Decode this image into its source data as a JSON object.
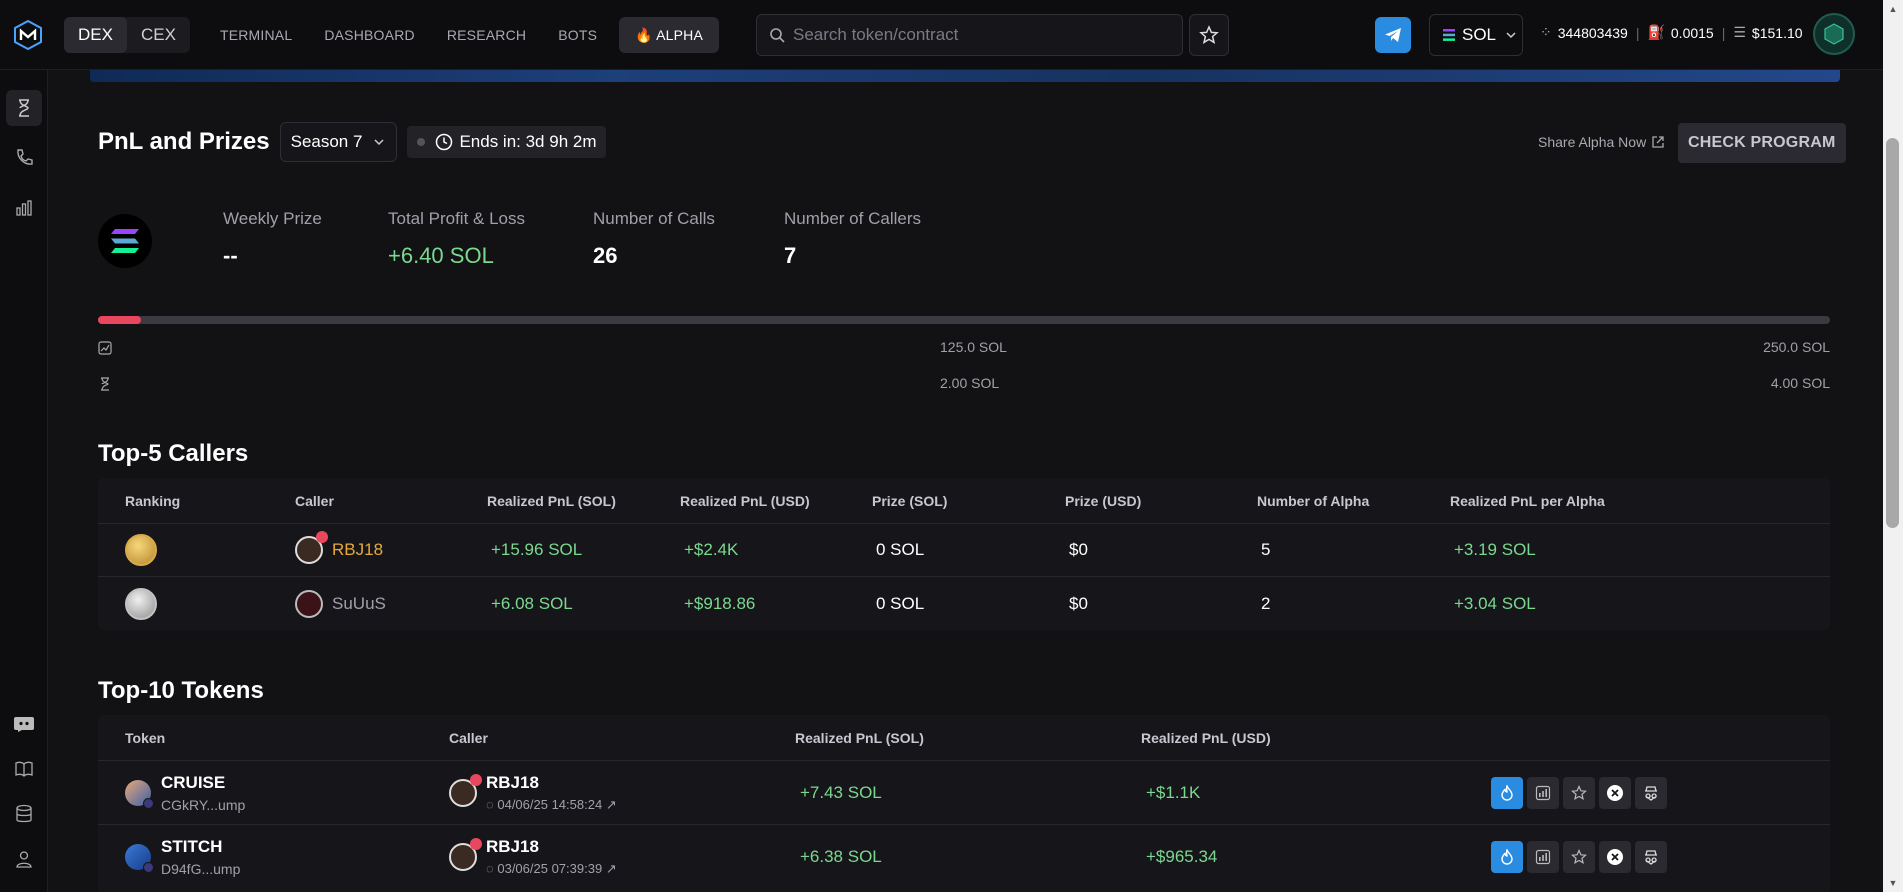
{
  "topbar": {
    "mode_tabs": [
      "DEX",
      "CEX"
    ],
    "nav": [
      "TERMINAL",
      "DASHBOARD",
      "RESEARCH",
      "BOTS"
    ],
    "alpha_label": "ALPHA",
    "search_placeholder": "Search token/contract",
    "chain": "SOL",
    "stats": {
      "block": "344803439",
      "gas": "0.0015",
      "price": "$151.10"
    }
  },
  "header": {
    "title": "PnL and Prizes",
    "season": "Season 7",
    "ends": "Ends in: 3d 9h 2m",
    "share": "Share Alpha Now",
    "check_program": "CHECK PROGRAM"
  },
  "metrics": {
    "weekly_prize_label": "Weekly Prize",
    "weekly_prize": "--",
    "total_pnl_label": "Total Profit & Loss",
    "total_pnl": "+6.40 SOL",
    "calls_label": "Number of Calls",
    "calls": "26",
    "callers_label": "Number of Callers",
    "callers": "7"
  },
  "progress": {
    "fill_fraction": 0.025,
    "pnl_mid": "125.0 SOL",
    "pnl_end": "250.0 SOL",
    "prize_mid": "2.00 SOL",
    "prize_end": "4.00 SOL"
  },
  "top_callers": {
    "title": "Top-5 Callers",
    "headers": [
      "Ranking",
      "Caller",
      "Realized PnL (SOL)",
      "Realized PnL (USD)",
      "Prize (SOL)",
      "Prize (USD)",
      "Number of Alpha",
      "Realized PnL per Alpha"
    ],
    "rows": [
      {
        "caller": "RBJ18",
        "pnl_sol": "+15.96 SOL",
        "pnl_usd": "+$2.4K",
        "prize_sol": "0 SOL",
        "prize_usd": "$0",
        "alpha": "5",
        "per_alpha": "+3.19 SOL"
      },
      {
        "caller": "SuUuS",
        "pnl_sol": "+6.08 SOL",
        "pnl_usd": "+$918.86",
        "prize_sol": "0 SOL",
        "prize_usd": "$0",
        "alpha": "2",
        "per_alpha": "+3.04 SOL"
      }
    ]
  },
  "top_tokens": {
    "title": "Top-10 Tokens",
    "headers": [
      "Token",
      "Caller",
      "Realized PnL (SOL)",
      "Realized PnL (USD)"
    ],
    "rows": [
      {
        "name": "CRUISE",
        "addr": "CGkRY...ump",
        "caller": "RBJ18",
        "time": "04/06/25 14:58:24",
        "pnl_sol": "+7.43 SOL",
        "pnl_usd": "+$1.1K"
      },
      {
        "name": "STITCH",
        "addr": "D94fG...ump",
        "caller": "RBJ18",
        "time": "03/06/25 07:39:39",
        "pnl_sol": "+6.38 SOL",
        "pnl_usd": "+$965.34"
      }
    ]
  },
  "colors": {
    "accent": "#2a8ce0",
    "positive": "#7bd88f",
    "progress": "#e8475d",
    "gold": "#e8a93a"
  }
}
